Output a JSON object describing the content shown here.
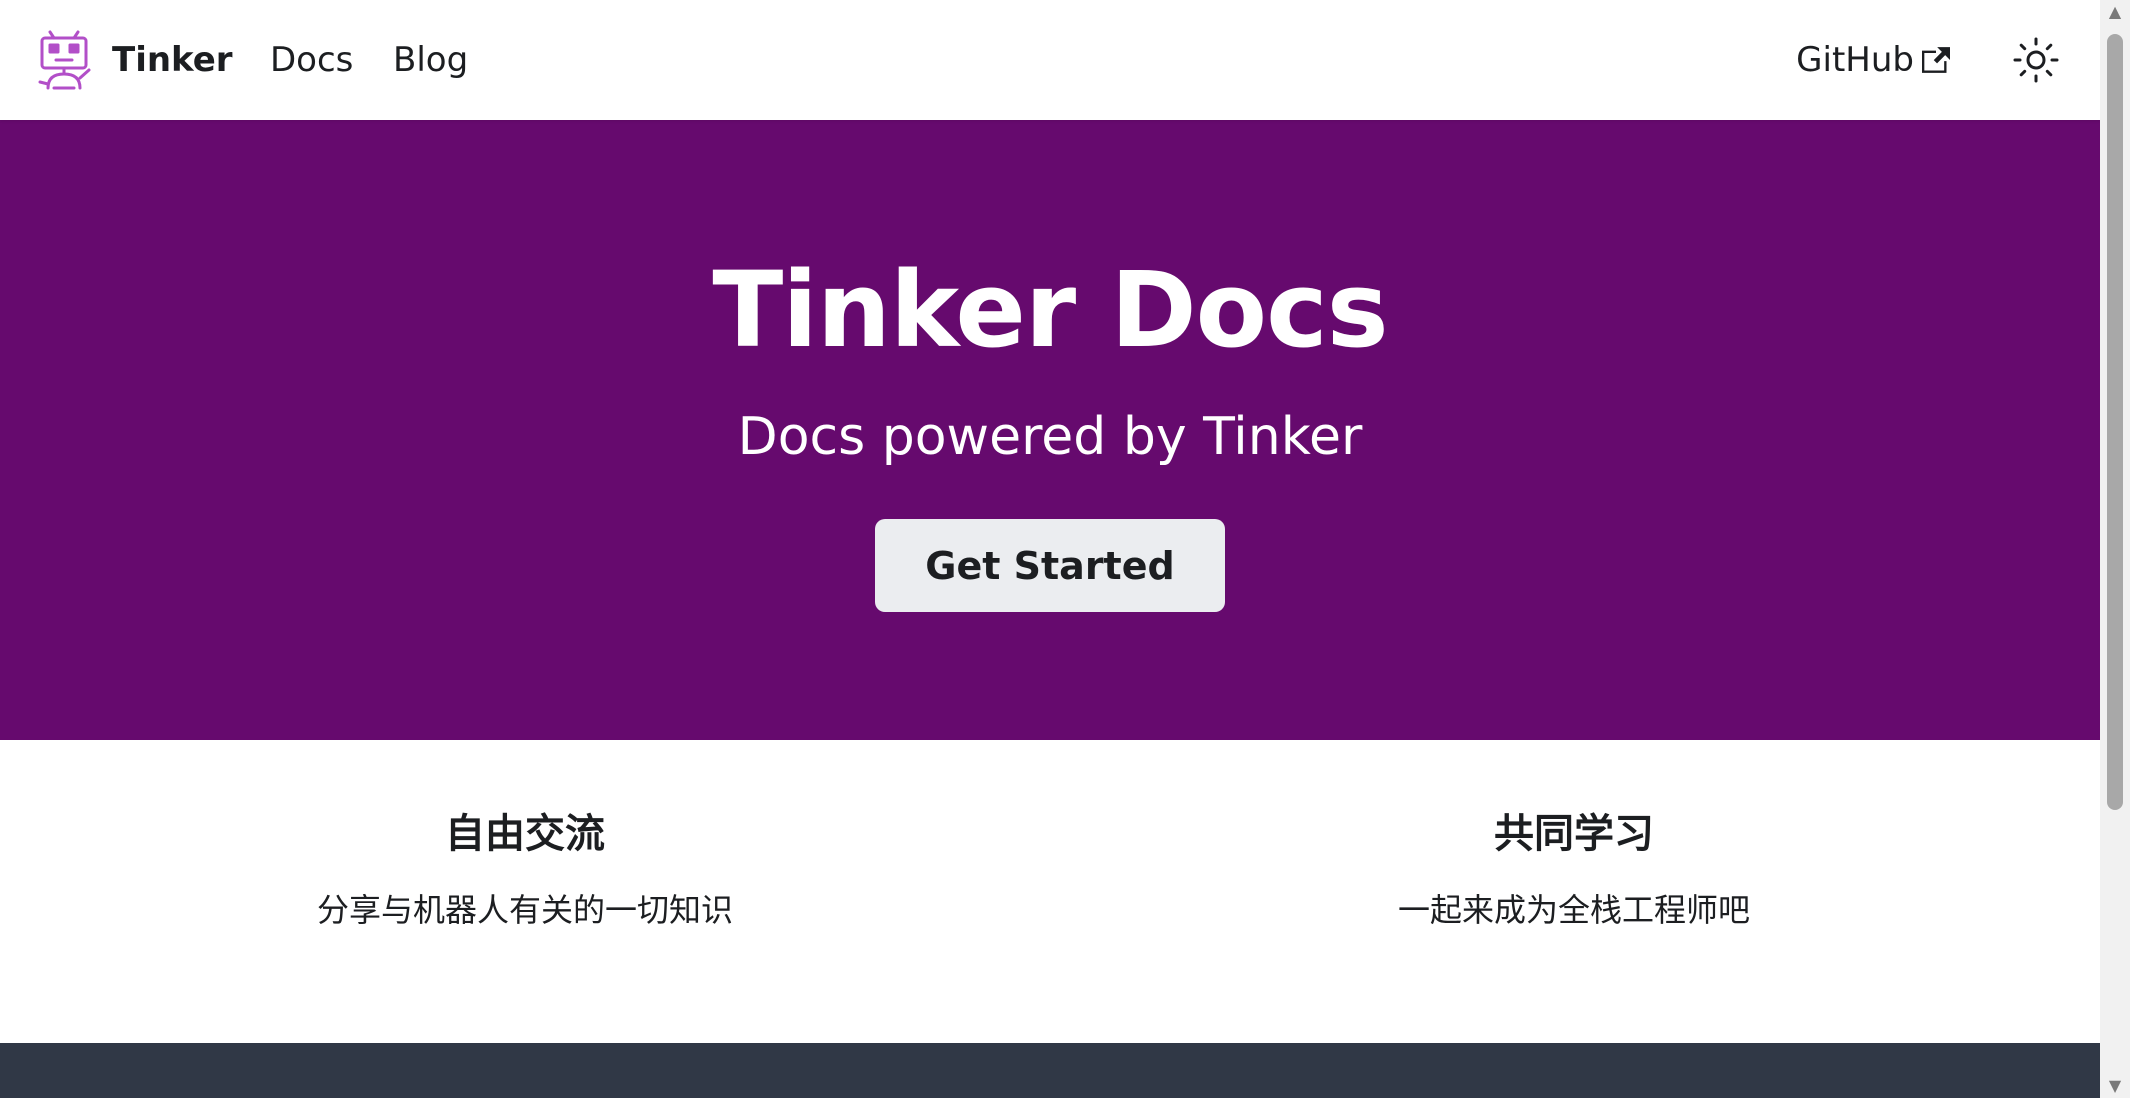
{
  "colors": {
    "hero_background": "#660a6e",
    "button_background": "#ebedf0",
    "footer_background": "#303846",
    "logo_accent": "#b24fc8",
    "text_dark": "#1c1e21"
  },
  "navbar": {
    "brand": {
      "title": "Tinker",
      "logo_icon": "robot-logo-icon"
    },
    "links": [
      {
        "label": "Docs"
      },
      {
        "label": "Blog"
      }
    ],
    "github": {
      "label": "GitHub",
      "icon": "external-link-icon"
    },
    "theme_toggle": {
      "icon": "sun-icon"
    }
  },
  "hero": {
    "title": "Tinker Docs",
    "subtitle": "Docs powered by Tinker",
    "cta_label": "Get Started"
  },
  "features": [
    {
      "title": "自由交流",
      "description": "分享与机器人有关的一切知识"
    },
    {
      "title": "共同学习",
      "description": "一起来成为全栈工程师吧"
    }
  ],
  "scrollbar": {
    "up_icon": "arrow-up-icon",
    "down_icon": "arrow-down-icon"
  }
}
